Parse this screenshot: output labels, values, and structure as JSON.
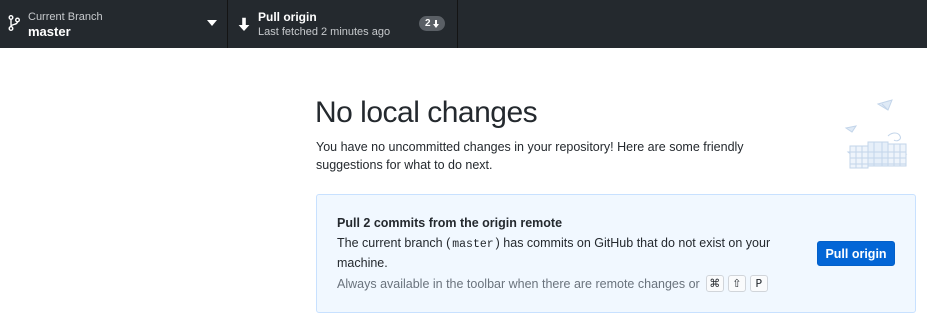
{
  "toolbar": {
    "branch": {
      "title": "Current Branch",
      "description": "master",
      "icon": "git-branch-icon",
      "caret_icon": "triangle-down-icon"
    },
    "pull": {
      "title": "Pull origin",
      "description": "Last fetched 2 minutes ago",
      "icon": "arrow-down-icon",
      "badge_count": "2"
    }
  },
  "main": {
    "heading": "No local changes",
    "intro": "You have no uncommitted changes in your repository! Here are some friendly suggestions for what to do next."
  },
  "card": {
    "title": "Pull 2 commits from the origin remote",
    "desc_before": "The current branch (",
    "branch_code": "master",
    "desc_after": ") has commits on GitHub that do not exist on your machine.",
    "hint": "Always available in the toolbar when there are remote changes or",
    "shortcut_keys": [
      "⌘",
      "⇧",
      "P"
    ],
    "button_label": "Pull origin"
  },
  "colors": {
    "toolbar_bg": "#24292e",
    "accent_blue": "#0366d6",
    "card_bg": "#f1f8ff",
    "card_border": "#c8e1ff"
  }
}
